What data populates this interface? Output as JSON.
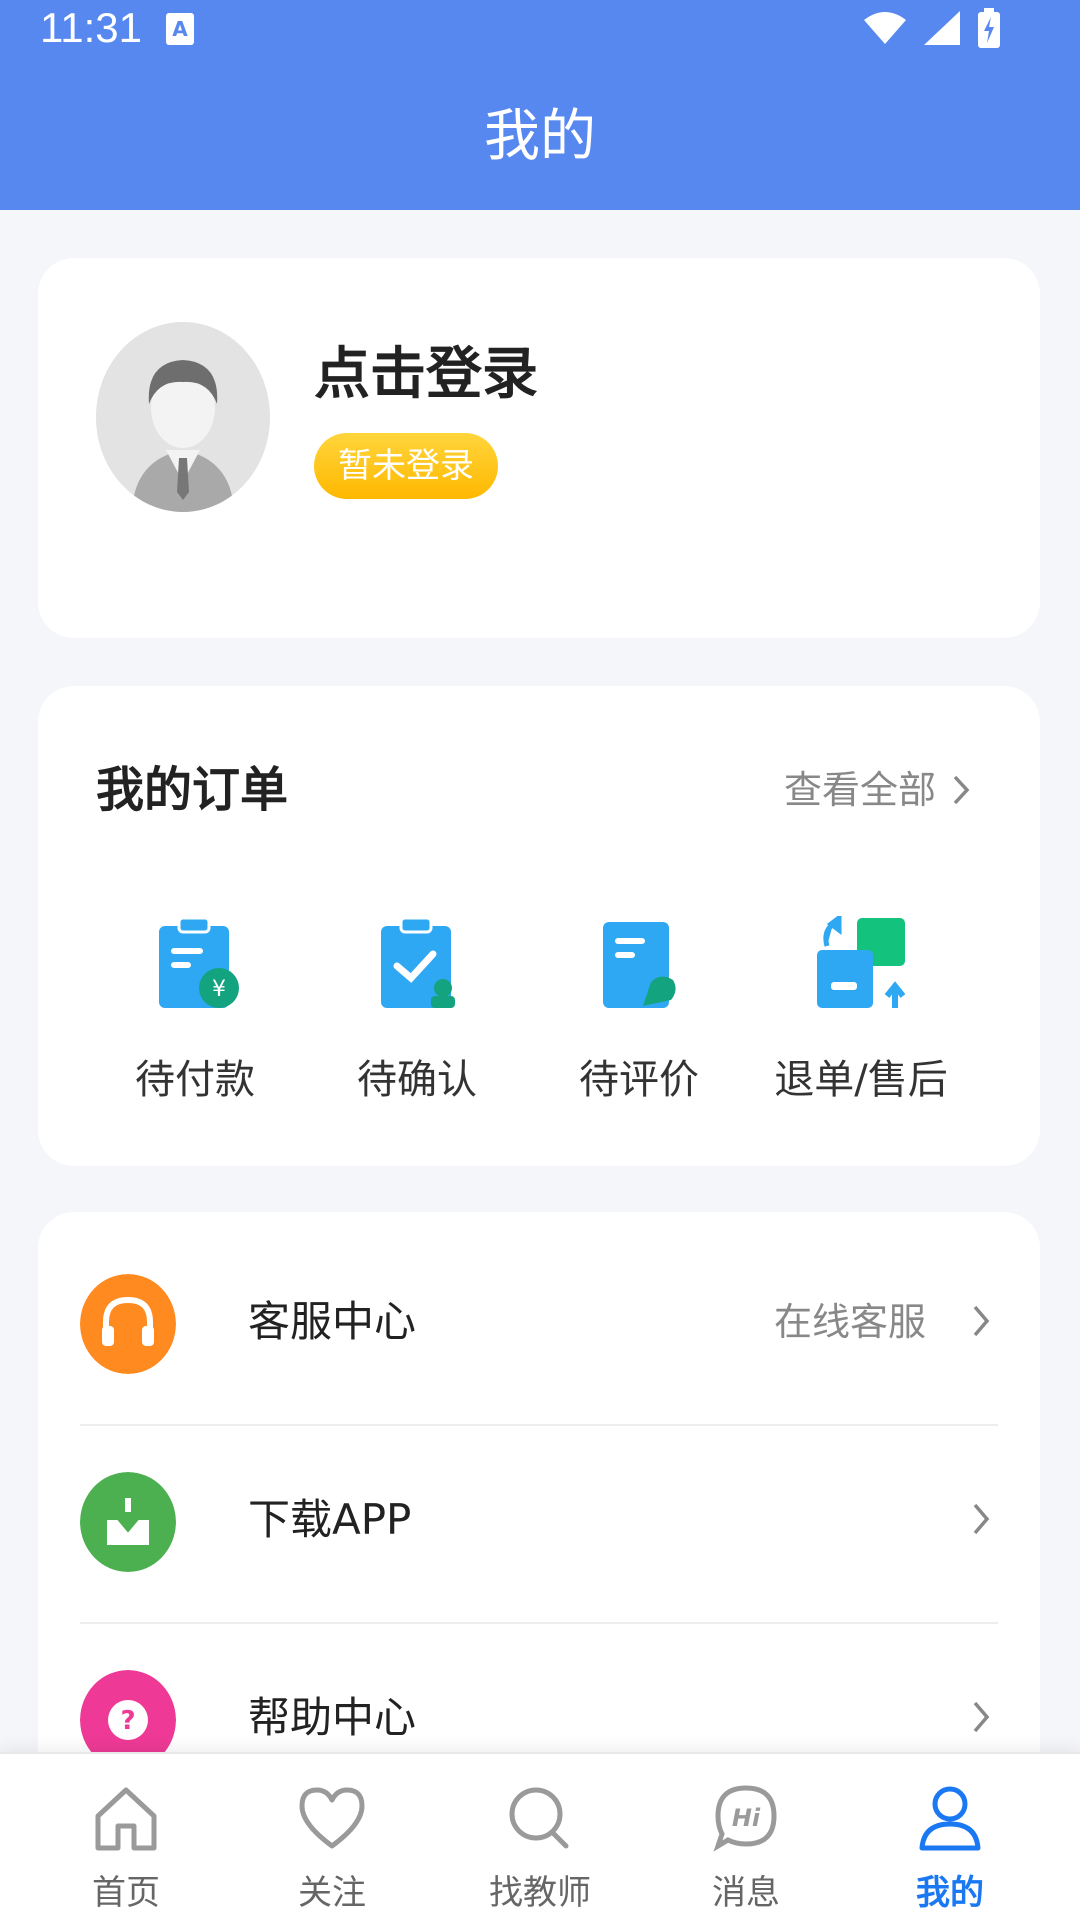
{
  "status_bar": {
    "time": "11:31",
    "notification_icon": "A"
  },
  "header": {
    "title": "我的"
  },
  "profile": {
    "login_title": "点击登录",
    "badge": "暂未登录"
  },
  "orders": {
    "title": "我的订单",
    "view_all": "查看全部",
    "items": [
      {
        "label": "待付款",
        "icon": "pending-payment-icon"
      },
      {
        "label": "待确认",
        "icon": "pending-confirm-icon"
      },
      {
        "label": "待评价",
        "icon": "pending-review-icon"
      },
      {
        "label": "退单/售后",
        "icon": "refund-aftersale-icon"
      }
    ]
  },
  "menu": {
    "items": [
      {
        "label": "客服中心",
        "extra": "在线客服",
        "icon": "headset-icon",
        "color": "#FF8A1F"
      },
      {
        "label": "下载APP",
        "extra": "",
        "icon": "download-icon",
        "color": "#4CB050"
      },
      {
        "label": "帮助中心",
        "extra": "",
        "icon": "help-icon",
        "color": "#EE3A96"
      }
    ]
  },
  "bottom_nav": {
    "items": [
      {
        "label": "首页",
        "icon": "home-icon",
        "active": false
      },
      {
        "label": "关注",
        "icon": "heart-icon",
        "active": false
      },
      {
        "label": "找教师",
        "icon": "search-icon",
        "active": false
      },
      {
        "label": "消息",
        "icon": "message-hi-icon",
        "active": false
      },
      {
        "label": "我的",
        "icon": "profile-icon",
        "active": true
      }
    ]
  },
  "colors": {
    "header_bg": "#5788F0",
    "badge": "#FFC61A",
    "nav_active": "#1A78F2"
  }
}
